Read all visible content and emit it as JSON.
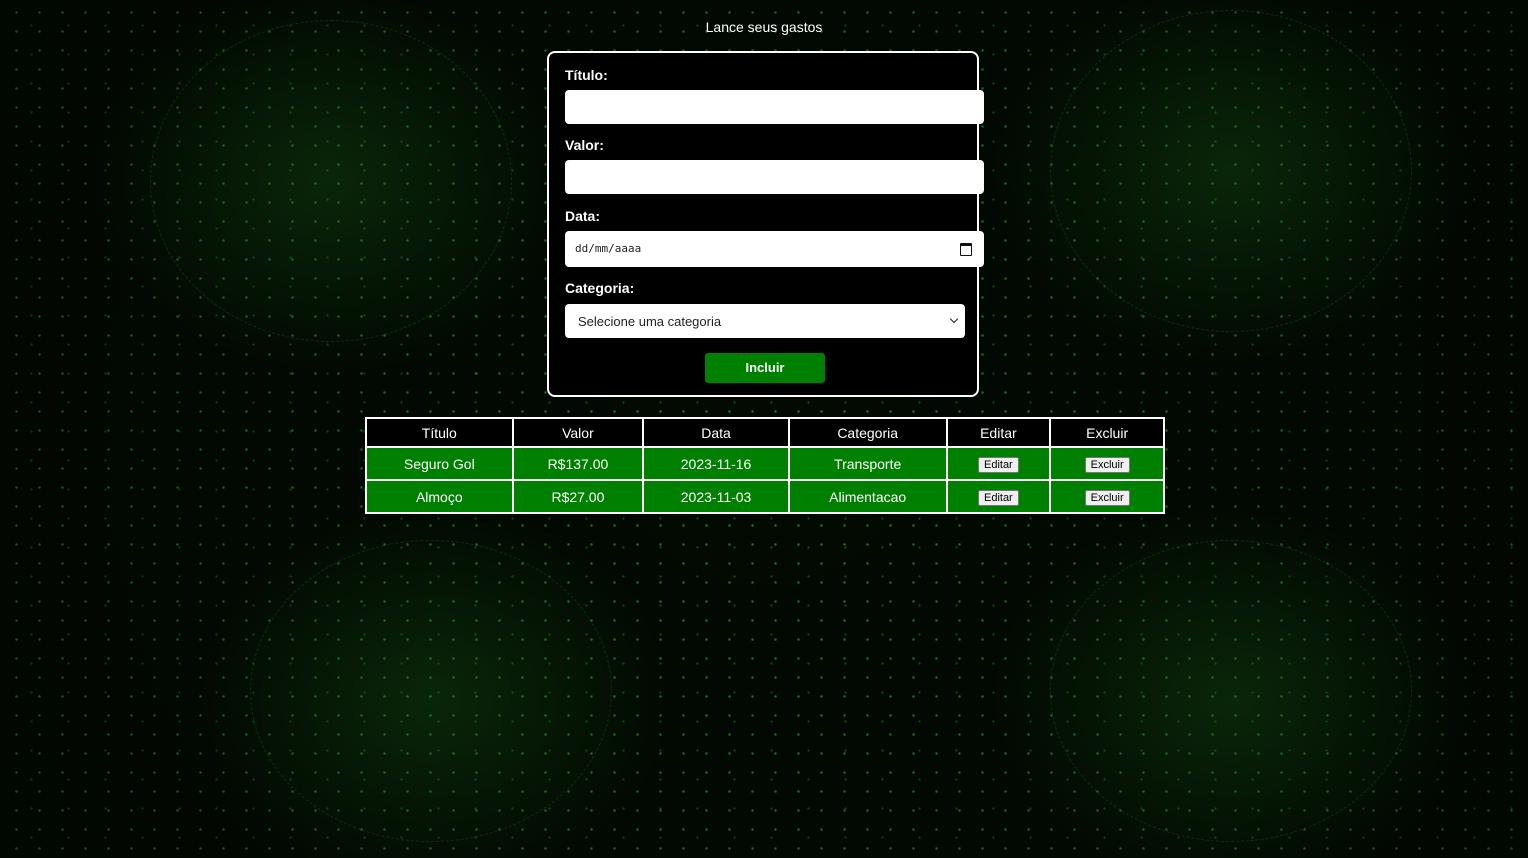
{
  "page": {
    "title": "Lance seus gastos"
  },
  "form": {
    "titulo_label": "Título:",
    "titulo_value": "",
    "valor_label": "Valor:",
    "valor_value": "",
    "data_label": "Data:",
    "data_placeholder": "dd/mm/aaaa",
    "categoria_label": "Categoria:",
    "categoria_selected": "Selecione uma categoria",
    "submit_label": "Incluir"
  },
  "table": {
    "headers": [
      "Título",
      "Valor",
      "Data",
      "Categoria",
      "Editar",
      "Excluir"
    ],
    "rows": [
      {
        "titulo": "Seguro Gol",
        "valor": "R$137.00",
        "data": "2023-11-16",
        "categoria": "Transporte",
        "editar": "Editar",
        "excluir": "Excluir"
      },
      {
        "titulo": "Almoço",
        "valor": "R$27.00",
        "data": "2023-11-03",
        "categoria": "Alimentacao",
        "editar": "Editar",
        "excluir": "Excluir"
      }
    ]
  },
  "colors": {
    "accent_green": "#008000",
    "background": "#020a02",
    "card_background": "#000000"
  }
}
